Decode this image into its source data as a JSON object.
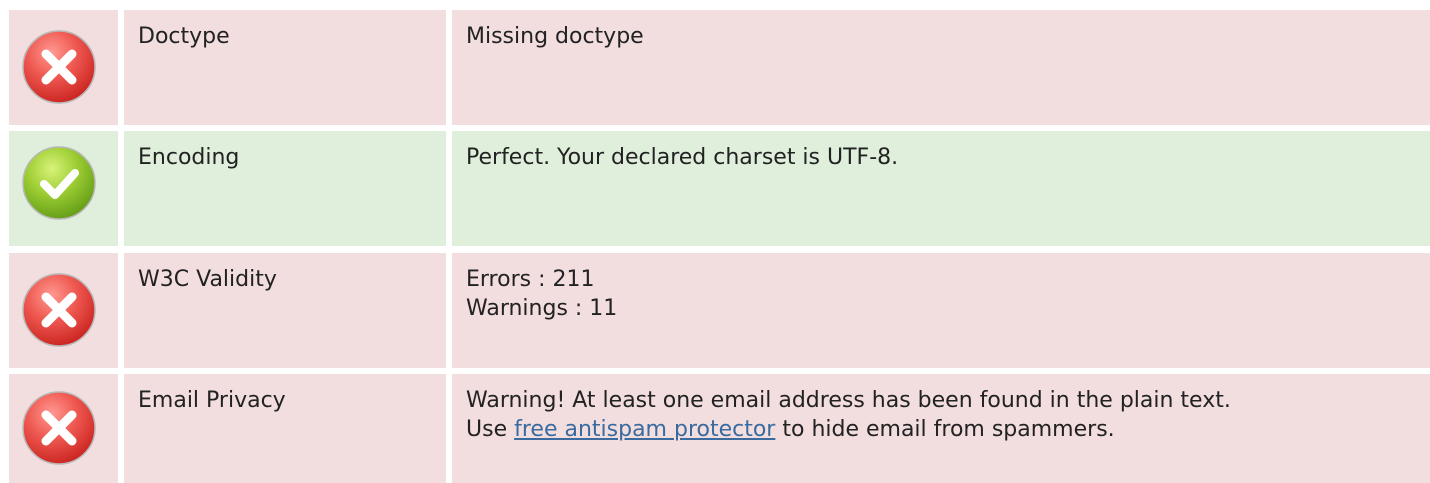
{
  "rows": [
    {
      "status": "error",
      "icon": "error-x-icon",
      "label": "Doctype",
      "desc": "Missing doctype"
    },
    {
      "status": "ok",
      "icon": "check-icon",
      "label": "Encoding",
      "desc": "Perfect. Your declared charset is UTF-8."
    },
    {
      "status": "error",
      "icon": "error-x-icon",
      "label": "W3C Validity",
      "desc_line1": "Errors : 211",
      "desc_line2": "Warnings : 11"
    },
    {
      "status": "error",
      "icon": "error-x-icon",
      "label": "Email Privacy",
      "desc_line1": "Warning! At least one email address has been found in the plain text.",
      "desc_line2_prefix": "Use",
      "link_text": "free antispam protector",
      "desc_line2_suffix": "to hide email from spammers."
    }
  ],
  "colors": {
    "error_bg": "#f2dddf",
    "ok_bg": "#dfefdb",
    "error_icon": "#e04848",
    "ok_icon": "#8cc63e",
    "link": "#3a6a9e"
  }
}
